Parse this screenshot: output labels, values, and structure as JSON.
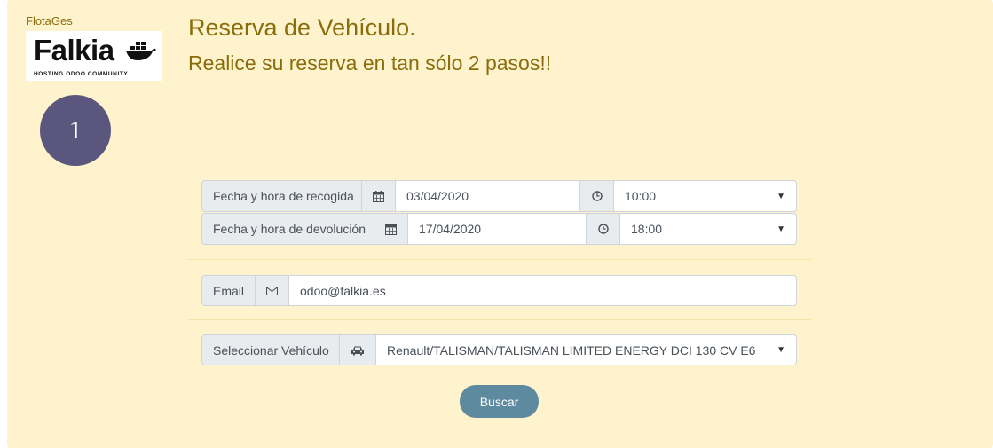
{
  "brand": {
    "app_name": "FlotaGes",
    "logo_word": "Falkia",
    "logo_tagline": "HOSTING ODOO COMMUNITY"
  },
  "step": {
    "number": "1"
  },
  "header": {
    "title": "Reserva de Vehículo.",
    "subtitle": "Realice su reserva en tan sólo 2 pasos!!"
  },
  "form": {
    "pickup": {
      "label": "Fecha y hora de recogida",
      "date": "03/04/2020",
      "time": "10:00"
    },
    "return": {
      "label": "Fecha y hora de devolución",
      "date": "17/04/2020",
      "time": "18:00"
    },
    "email": {
      "label": "Email",
      "value": "odoo@falkia.es"
    },
    "vehicle": {
      "label": "Seleccionar Vehículo",
      "value": "Renault/TALISMAN/TALISMAN LIMITED ENERGY DCI 130 CV E6"
    },
    "search_button": "Buscar"
  },
  "icons": {
    "date": "calendar-icon",
    "time": "clock-icon",
    "email": "envelope-icon",
    "vehicle": "car-icon",
    "logo": "docker-whale-icon"
  },
  "colors": {
    "panel": "#fff3cd",
    "heading": "#8a6d0b",
    "step_circle": "#5a567e",
    "button": "#5e8aa0"
  }
}
